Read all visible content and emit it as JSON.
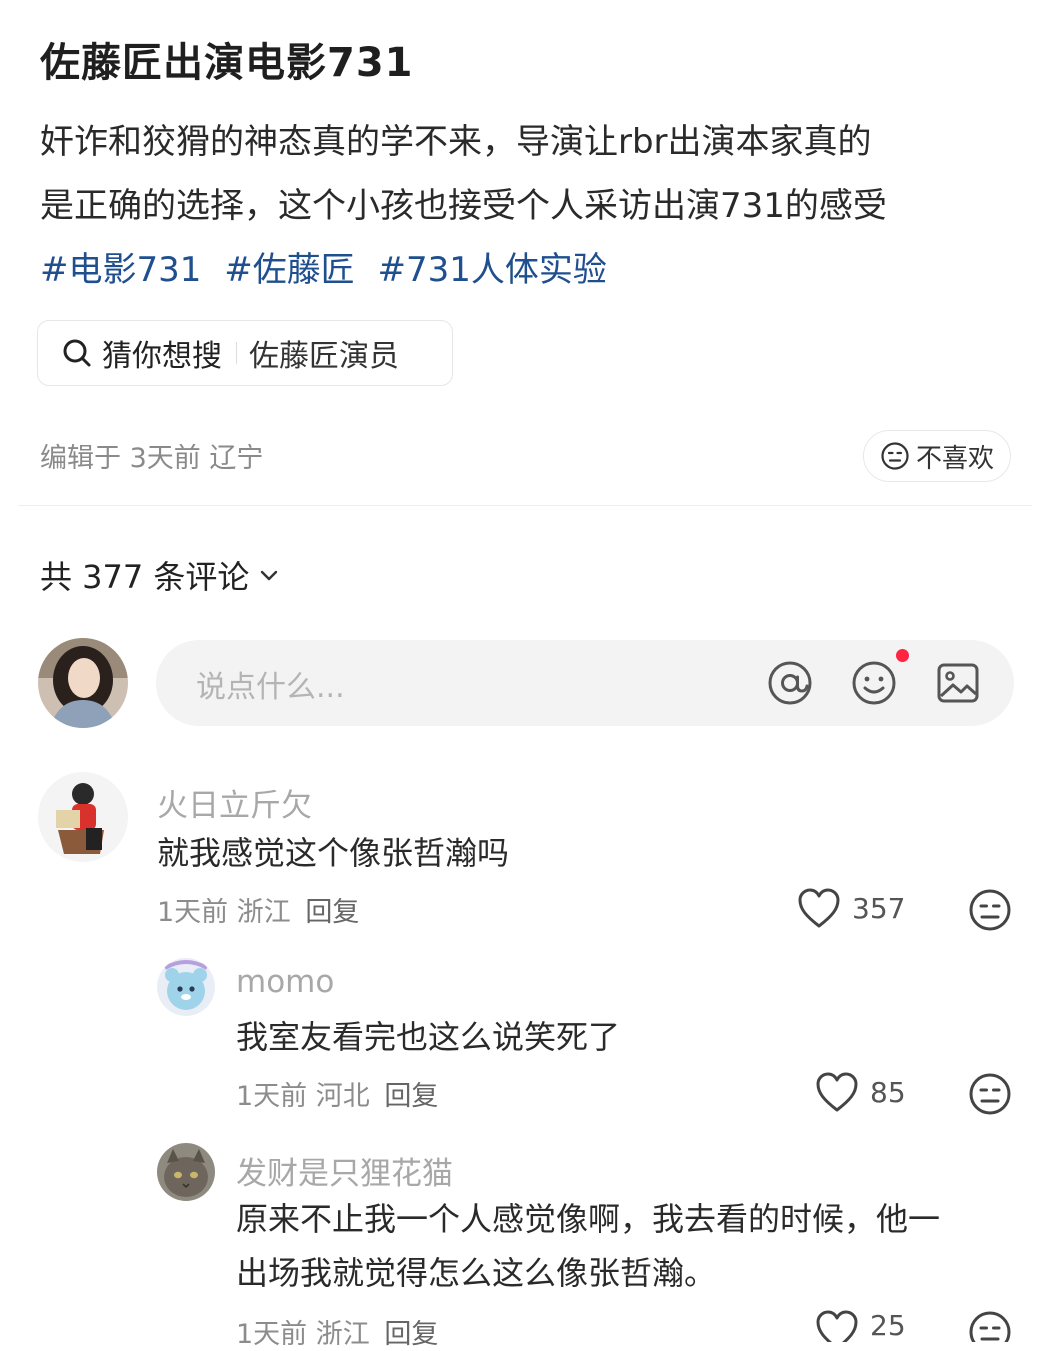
{
  "post": {
    "title": "佐藤匠出演电影731",
    "body_lines": [
      "奸诈和狡猾的神态真的学不来，导演让rbr出演本家真的",
      "是正确的选择，这个小孩也接受个人采访出演731的感受"
    ],
    "tags": [
      "#电影731",
      "#佐藤匠",
      "#731人体实验"
    ],
    "guess_label": "猜你想搜",
    "guess_term": "佐藤匠演员",
    "meta": "编辑于 3天前 辽宁",
    "dislike_label": "不喜欢"
  },
  "comments_header": {
    "count_text": "共 377 条评论"
  },
  "comment_input": {
    "placeholder": "说点什么..."
  },
  "comments": [
    {
      "user": "火日立斤欠",
      "text": "就我感觉这个像张哲瀚吗",
      "meta": "1天前 浙江",
      "reply_label": "回复",
      "likes": "357"
    },
    {
      "user": "momo",
      "text": "我室友看完也这么说笑死了",
      "meta": "1天前 河北",
      "reply_label": "回复",
      "likes": "85"
    },
    {
      "user": "发财是只狸花猫",
      "text_lines": [
        "原来不止我一个人感觉像啊，我去看的时候，他一",
        "出场我就觉得怎么这么像张哲瀚。"
      ],
      "meta": "1天前 浙江",
      "reply_label": "回复",
      "likes": "25"
    }
  ],
  "colors": {
    "tag": "#1f4f8e",
    "notification_dot": "#ff2442",
    "input_bg": "#f3f3f3"
  },
  "icons": [
    "search-icon",
    "neutral-face-icon",
    "chevron-down-icon",
    "at-icon",
    "emoji-icon",
    "image-icon",
    "heart-icon"
  ]
}
